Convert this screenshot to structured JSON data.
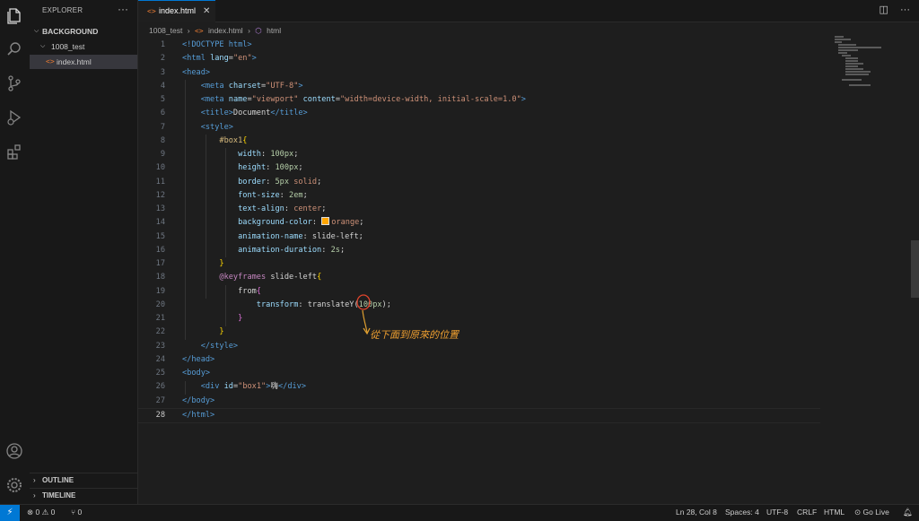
{
  "activity_bar": {
    "icons": [
      "files-icon",
      "search-icon",
      "source-control-icon",
      "run-debug-icon",
      "extensions-icon",
      "account-icon",
      "settings-gear-icon"
    ]
  },
  "sidebar": {
    "title": "EXPLORER",
    "more": "···",
    "root_folder": "BACKGROUND",
    "folder": "1008_test",
    "file": "index.html",
    "file_icon": "<>",
    "outline": "OUTLINE",
    "timeline": "TIMELINE"
  },
  "tab": {
    "label": "index.html",
    "icon": "<>",
    "close": "✕"
  },
  "breadcrumb": {
    "folder": "1008_test",
    "file": "index.html",
    "symbol": "html",
    "sep": "›"
  },
  "code": {
    "line_numbers": [
      "1",
      "2",
      "3",
      "4",
      "5",
      "6",
      "7",
      "8",
      "9",
      "10",
      "11",
      "12",
      "13",
      "14",
      "15",
      "16",
      "17",
      "18",
      "19",
      "20",
      "21",
      "22",
      "23",
      "24",
      "25",
      "26",
      "27",
      "28"
    ],
    "current_line": "28",
    "doctype": "<!DOCTYPE html>",
    "l2": {
      "open": "<html",
      "attr": "lang",
      "eq": "=",
      "val": "\"en\"",
      "close": ">"
    },
    "l3": "<head>",
    "l4": {
      "open": "<meta",
      "attr": "charset",
      "eq": "=",
      "val": "\"UTF-8\"",
      "close": ">"
    },
    "l5": {
      "open": "<meta",
      "attr1": "name",
      "eq": "=",
      "val1": "\"viewport\"",
      "attr2": "content",
      "val2": "\"width=device-width, initial-scale=1.0\"",
      "close": ">"
    },
    "l6": {
      "open": "<title>",
      "text": "Document",
      "close": "</title>"
    },
    "l7": "<style>",
    "l8": {
      "sel": "#box1",
      "brace": "{"
    },
    "l9": {
      "prop": "width",
      "colon": ": ",
      "val": "100px",
      "semi": ";"
    },
    "l10": {
      "prop": "height",
      "colon": ": ",
      "val": "100px",
      "semi": ";"
    },
    "l11": {
      "prop": "border",
      "colon": ": ",
      "num": "5px",
      "val": " solid",
      "semi": ";"
    },
    "l12": {
      "prop": "font-size",
      "colon": ": ",
      "val": "2em",
      "semi": ";"
    },
    "l13": {
      "prop": "text-align",
      "colon": ": ",
      "val": "center",
      "semi": ";"
    },
    "l14": {
      "prop": "background-color",
      "colon": ": ",
      "val": "orange",
      "semi": ";"
    },
    "l15": {
      "prop": "animation-name",
      "colon": ": ",
      "val": "slide-left",
      "semi": ";"
    },
    "l16": {
      "prop": "animation-duration",
      "colon": ": ",
      "val": "2s",
      "semi": ";"
    },
    "l17": "}",
    "l18": {
      "kw": "@keyframes",
      "name": " slide-left",
      "brace": "{"
    },
    "l19": {
      "kw": "from",
      "brace": "{"
    },
    "l20": {
      "prop": "transform",
      "colon": ": ",
      "fn": "translateY",
      "paren_open": "(",
      "val": "100px",
      "paren_close": ")",
      "semi": ";"
    },
    "l21": "}",
    "l22": "}",
    "l23": "</style>",
    "l24": "</head>",
    "l25": "<body>",
    "l26": {
      "open": "<div",
      "attr": "id",
      "eq": "=",
      "val": "\"box1\"",
      "gt": ">",
      "text": "嗨",
      "close": "</div>"
    },
    "l27": "</body>",
    "l28": "</html>"
  },
  "annotation": "從下面到原來的位置",
  "status": {
    "errors": "0",
    "warnings": "0",
    "ports": "0",
    "position": "Ln 28, Col 8",
    "spaces": "Spaces: 4",
    "encoding": "UTF-8",
    "eol": "CRLF",
    "language": "HTML",
    "golive": "Go Live"
  },
  "colors": {
    "accent": "#0078d4",
    "annotation": "#f0a030",
    "swatch": "#ffa500"
  }
}
